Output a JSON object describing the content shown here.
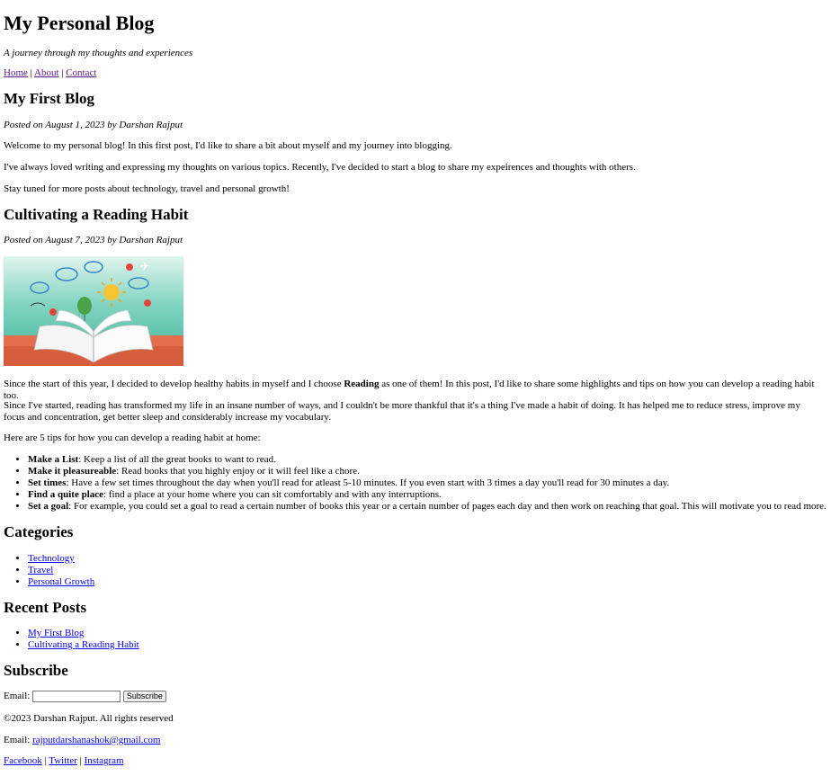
{
  "header": {
    "title": "My Personal Blog",
    "tagline": "A journey through my thoughts and experiences",
    "nav": [
      "Home",
      "About",
      "Contact"
    ]
  },
  "posts": [
    {
      "title": "My First Blog",
      "meta": "Posted on August 1, 2023 by Darshan Rajput",
      "paragraphs": [
        "Welcome to my personal blog! In this first post, I'd like to share a bit about myself and my journey into blogging.",
        "I've always loved writing and expressing my thoughts on various topics. Recently, I've decided to start a blog to share my expeirences and thoughts with others.",
        "Stay tuned for more posts about technology, travel and personal growth!"
      ]
    },
    {
      "title": "Cultivating a Reading Habit",
      "meta": "Posted on August 7, 2023 by Darshan Rajput",
      "intro_before": "Since the start of this year, I decided to develop healthy habits in myself and I choose ",
      "intro_bold": "Reading",
      "intro_after": " as one of them! In this post, I'd like to share some highlights and tips on how you can develop a reading habit too.",
      "para2": "Since I've started, reading has transformed my life in an insane number of ways, and I couldn't be more thankful that it's a thing I've made a habit of doing. It has helped me to reduce stress, improve my focus and concentration, get better sleep and considerably increase my vocabulary.",
      "para3": "Here are 5 tips for how you can develop a reading habit at home:",
      "tips": [
        {
          "bold": "Make a List",
          "text": ": Keep a list of all the great books to want to read."
        },
        {
          "bold": "Make it pleasureable",
          "text": ": Read books that you highly enjoy or it will feel like a chore."
        },
        {
          "bold": "Set times",
          "text": ": Have a few set times throughout the day when you'll read for atleast 5-10 minutes. If you even start with 3 times a day you'll read for 30 minutes a day."
        },
        {
          "bold": "Find a quite place",
          "text": ": find a place at your home where you can sit comfortably and with any interruptions."
        },
        {
          "bold": "Set a goal",
          "text": ": For example, you could set a goal to read a certain number of books this year or a certain number of pages each day and then work on reaching that goal. This will motivate you to read more."
        }
      ]
    }
  ],
  "categories": {
    "heading": "Categories",
    "items": [
      "Technology",
      "Travel",
      "Personal Growth"
    ]
  },
  "recent": {
    "heading": "Recent Posts",
    "items": [
      "My First Blog",
      "Cultivating a Reading Habit"
    ]
  },
  "subscribe": {
    "heading": "Subscribe",
    "email_label": "Email:",
    "email_value": "",
    "button": "Subscribe"
  },
  "footer": {
    "copyright": "©2023 Darshan Rajput. All rights reserved",
    "email_label": "Email: ",
    "email": "rajputdarshanashok@gmail.com",
    "social": [
      "Facebook",
      "Twitter",
      "Instagram"
    ]
  }
}
